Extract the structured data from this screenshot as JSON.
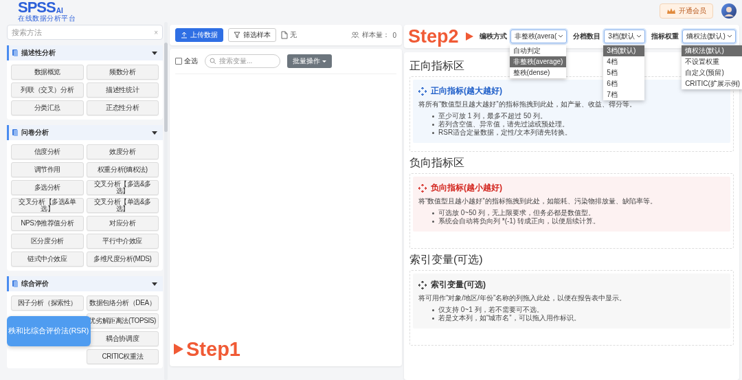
{
  "header": {
    "logo": "SPSS",
    "logo_badge": "AI",
    "subtitle": "在线数据分析平台",
    "vip_button": "开通会员"
  },
  "sidebar": {
    "search_placeholder": "搜索方法",
    "clear": "×",
    "groups": [
      {
        "title": "描述性分析",
        "expanded": true,
        "methods": [
          "数据概览",
          "频数分析",
          "列联（交叉）分析",
          "描述性统计",
          "分类汇总",
          "正态性分析"
        ]
      },
      {
        "title": "问卷分析",
        "expanded": true,
        "methods": [
          "信度分析",
          "效度分析",
          "调节作用",
          "权重分析(熵权法)",
          "多选分析",
          "交叉分析【多选&多选】",
          "交叉分析【多选&单选】",
          "交叉分析【单选&多选】",
          "NPS净推荐值分析",
          "对应分析",
          "区分度分析",
          "平行中介效应",
          "链式中介效应",
          "多维尺度分析(MDS)"
        ]
      },
      {
        "title": "综合评价",
        "expanded": true,
        "tooltip": "秩和比综合评价法(RSR)",
        "methods": [
          "因子分析（探索性）",
          "数据包络分析（DEA）",
          "优劣解距离法(TOPSIS)",
          "耦合协调度",
          "CRITIC权重法"
        ]
      }
    ]
  },
  "annotations": [
    {
      "text": "Step1"
    },
    {
      "text": "Step2"
    }
  ],
  "data_panel": {
    "upload_button": "上传数据",
    "filter_button": "筛选样本",
    "file_name": "无",
    "sample_label": "样本量：",
    "sample_count": "0",
    "select_all": {
      "label": "全选",
      "checked": false
    },
    "search_placeholder": "搜索变量...",
    "batch_button": "批量操作"
  },
  "settings": [
    {
      "label": "编秩方式",
      "value": "非整秩(avera(",
      "options": [
        {
          "label": "自动判定",
          "selected": false
        },
        {
          "label": "非整秩(average)",
          "selected": true
        },
        {
          "label": "整秩(dense)",
          "selected": false
        }
      ]
    },
    {
      "label": "分档数目",
      "value": "3档(默认",
      "options": [
        {
          "label": "3档(默认)",
          "selected": true
        },
        {
          "label": "4档",
          "selected": false
        },
        {
          "label": "5档",
          "selected": false
        },
        {
          "label": "6档",
          "selected": false
        },
        {
          "label": "7档",
          "selected": false
        }
      ]
    },
    {
      "label": "指标权重",
      "value": "熵权法(默认)",
      "options": [
        {
          "label": "熵权法(默认)",
          "selected": true
        },
        {
          "label": "不设置权重",
          "selected": false
        },
        {
          "label": "自定义(预留)",
          "selected": false
        },
        {
          "label": "CRITIC(扩展示例)",
          "selected": false
        }
      ]
    }
  ],
  "zones": [
    {
      "kind": "positive",
      "heading": "正向指标区",
      "title": "正向指标(越大越好)",
      "description": "将所有“数值型且越大越好”的指标拖拽到此处，如产量、收益、得分等。",
      "notes": [
        "至少可放 1 列，最多不超过 50 列。",
        "若列含空值、异常值，请先过滤或预处理。",
        "RSR适合定量数据，定性/文本列请先转换。"
      ]
    },
    {
      "kind": "negative",
      "heading": "负向指标区",
      "title": "负向指标(越小越好)",
      "description": "将“数值型且越小越好”的指标拖拽到此处，如能耗、污染物排放量、缺陷率等。",
      "notes": [
        "可选放 0~50 列，无上限要求，但务必都是数值型。",
        "系统会自动将负向列 *(-1) 转成正向，以便后续计算。"
      ]
    },
    {
      "kind": "index",
      "heading": "索引变量(可选)",
      "title": "索引变量(可选)",
      "description": "将可用作“对象/地区/年份”名称的列拖入此处，以便在报告表中显示。",
      "notes": [
        "仅支持 0~1 列，若不需要可不选。",
        "若是文本列，如“城市名”，可以拖入用作标识。"
      ]
    }
  ]
}
